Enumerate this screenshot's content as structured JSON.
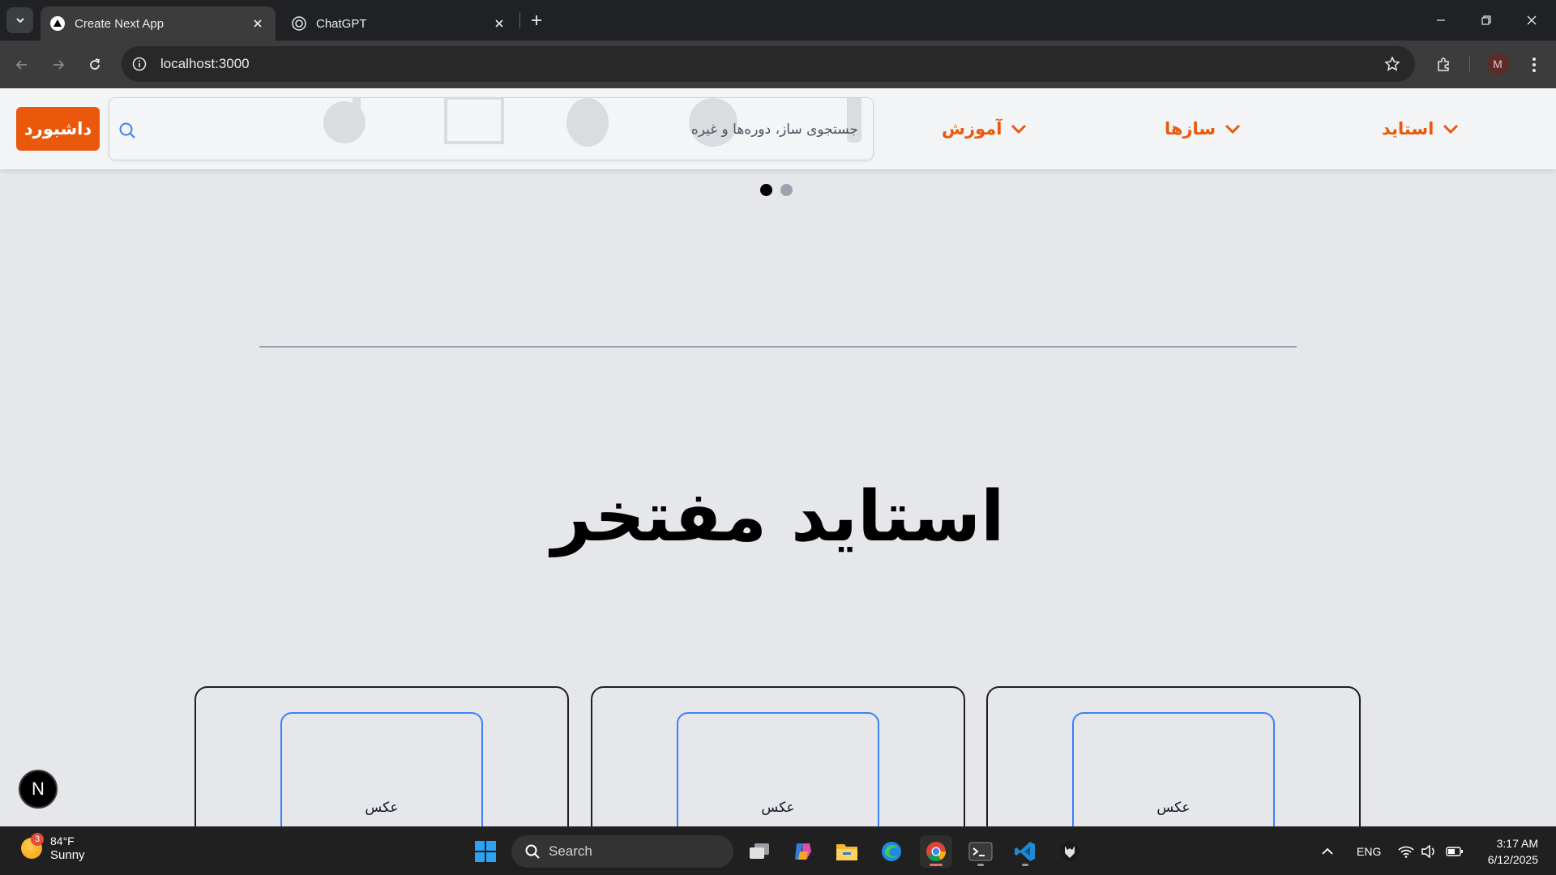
{
  "browser": {
    "tabs": [
      {
        "title": "Create Next App",
        "active": true,
        "icon": "nextjs-triangle-icon"
      },
      {
        "title": "ChatGPT",
        "active": false,
        "icon": "openai-icon"
      }
    ],
    "url": "localhost:3000",
    "profile_initial": "M"
  },
  "site": {
    "dashboard_label": "داشبورد",
    "search_placeholder": "جستجوی ساز، دوره‌ها و غیره",
    "nav": [
      {
        "label": "آموزش"
      },
      {
        "label": "سازها"
      },
      {
        "label": "استاید"
      }
    ],
    "carousel": {
      "total": 2,
      "active_index": 0
    },
    "section_title": "استاید مفتخر",
    "cards": [
      {
        "photo_label": "عکس"
      },
      {
        "photo_label": "عکس"
      },
      {
        "photo_label": "عکس"
      }
    ],
    "next_badge": "N"
  },
  "taskbar": {
    "weather": {
      "temp": "84°F",
      "condition": "Sunny",
      "badge": "3"
    },
    "search_label": "Search",
    "apps": [
      "task-view",
      "copilot",
      "file-explorer",
      "edge",
      "chrome",
      "terminal",
      "vscode",
      "wolf-app"
    ],
    "language": "ENG",
    "time": "3:17 AM",
    "date": "6/12/2025"
  },
  "colors": {
    "accent": "#ea580c",
    "page_bg": "#e5e7eb",
    "card_border": "#1f1f1f",
    "photo_border": "#3b82f6"
  }
}
